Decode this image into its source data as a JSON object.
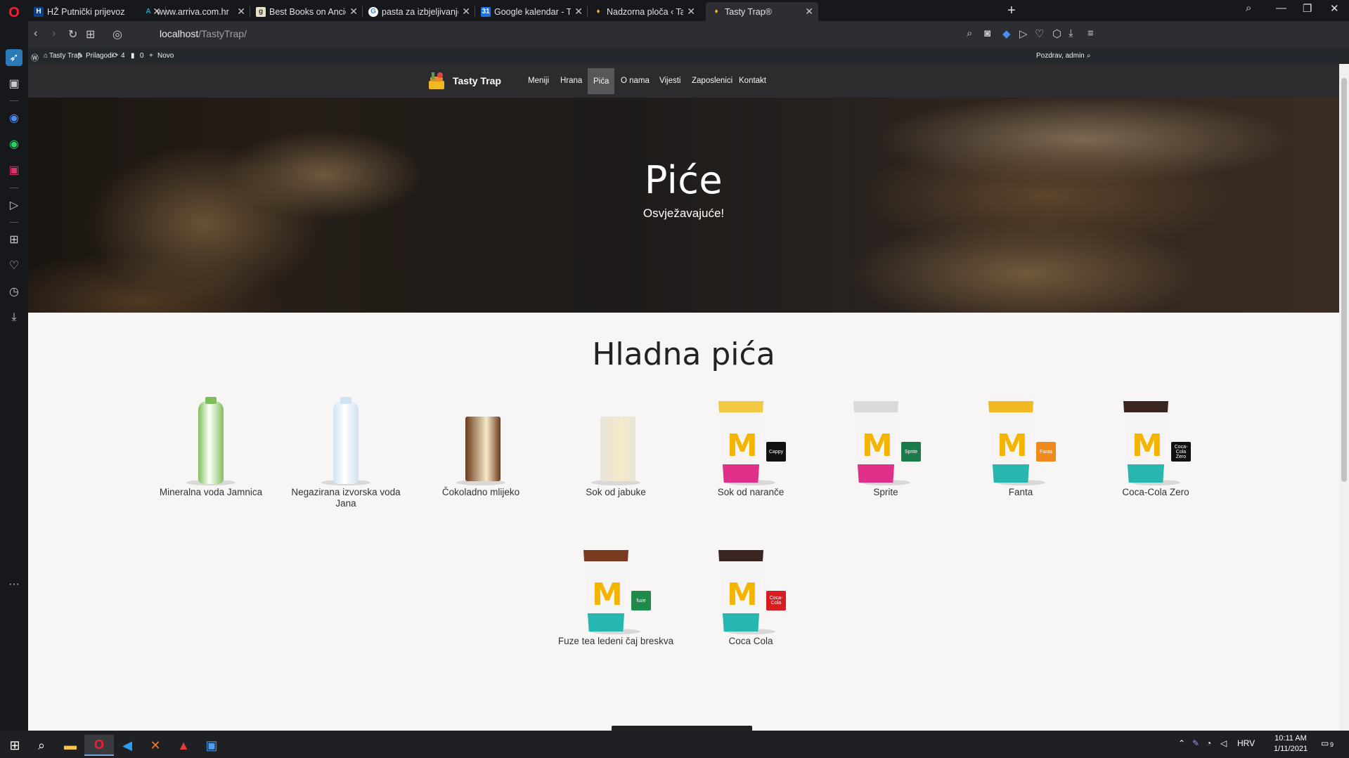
{
  "browser": {
    "tabs": [
      {
        "title": "HŽ Putnički prijevoz"
      },
      {
        "title": "www.arriva.com.hr"
      },
      {
        "title": "Best Books on Ancient Gre"
      },
      {
        "title": "pasta za izbjeljivanje zubi -"
      },
      {
        "title": "Google kalendar - Tjedan o"
      },
      {
        "title": "Nadzorna ploča ‹ Tasty Tra"
      },
      {
        "title": "Tasty Trap®"
      }
    ],
    "url_host": "localhost",
    "url_path": "/TastyTrap/"
  },
  "wp_admin": {
    "site_name": "Tasty Trap",
    "customize": "Prilagodi",
    "updates": "4",
    "comments": "0",
    "new": "Novo",
    "greeting": "Pozdrav, admin"
  },
  "site": {
    "brand": "Tasty Trap",
    "nav": [
      "Meniji",
      "Hrana",
      "Pića",
      "O nama",
      "Vijesti",
      "Zaposlenici",
      "Kontakt"
    ],
    "active_nav": "Pića"
  },
  "hero": {
    "title": "Piće",
    "subtitle": "Osvježavajuće!"
  },
  "section": {
    "title": "Hladna pića",
    "products": [
      {
        "name": "Mineralna voda Jamnica",
        "kind": "bottle",
        "color": "#7fbf5a"
      },
      {
        "name": "Negazirana izvorska voda Jana",
        "kind": "bottle",
        "color": "#cfe3f3"
      },
      {
        "name": "Čokoladno mlijeko",
        "kind": "carton",
        "color": "#6b3b1c"
      },
      {
        "name": "Sok od jabuke",
        "kind": "carton",
        "color": "#e8e4d8"
      },
      {
        "name": "Sok od naranče",
        "kind": "cup",
        "lid": "#f2c744",
        "band": "#e0308a",
        "badge": "#111111",
        "badge_text": "Cappy"
      },
      {
        "name": "Sprite",
        "kind": "cup",
        "lid": "#d9d9d9",
        "band": "#e0308a",
        "badge": "#1a7a4a",
        "badge_text": "Sprite"
      },
      {
        "name": "Fanta",
        "kind": "cup",
        "lid": "#f2b822",
        "band": "#27b7b0",
        "badge": "#f08a1c",
        "badge_text": "Fanta"
      },
      {
        "name": "Coca-Cola Zero",
        "kind": "cup",
        "lid": "#3a2520",
        "band": "#27b7b0",
        "badge": "#111111",
        "badge_text": "Coca-Cola Zero"
      },
      {
        "name": "Fuze tea ledeni čaj breskva",
        "kind": "cup",
        "lid": "#7a3a20",
        "band": "#27b7b0",
        "badge": "#1f8a4a",
        "badge_text": "fuze"
      },
      {
        "name": "Coca Cola",
        "kind": "cup",
        "lid": "#3a2520",
        "band": "#27b7b0",
        "badge": "#d71d24",
        "badge_text": "Coca-Cola"
      }
    ]
  },
  "taskbar": {
    "language": "HRV",
    "time": "10:11 AM",
    "date": "1/11/2021",
    "notifications": "9"
  }
}
